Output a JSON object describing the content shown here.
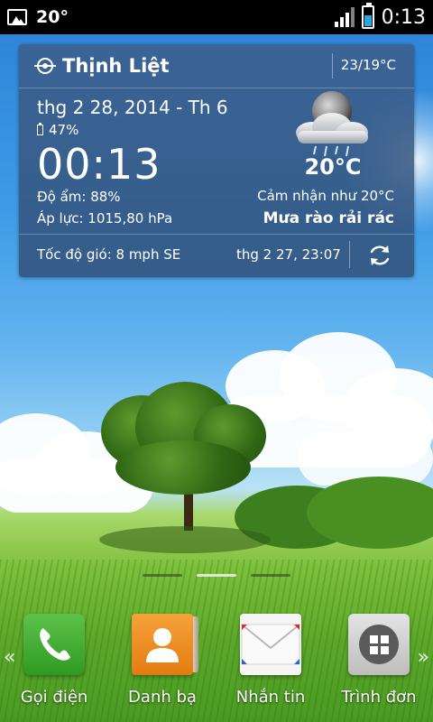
{
  "status_bar": {
    "temperature": "20°",
    "time": "0:13"
  },
  "weather_widget": {
    "location": "Thịnh Liệt",
    "hi_lo": "23/19°C",
    "date": "thg 2 28, 2014 - Th 6",
    "battery": "47%",
    "clock": "00:13",
    "humidity": "Độ ẩm: 88%",
    "pressure": "Áp lực: 1015,80 hPa",
    "temperature": "20°C",
    "feels_like": "Cảm nhận như 20°C",
    "condition": "Mưa rào rải rác",
    "wind": "Tốc độ gió: 8 mph SE",
    "updated": "thg 2 27, 23:07"
  },
  "home": {
    "page_count": 3,
    "active_page": 2
  },
  "dock": {
    "items": [
      {
        "label": "Gọi điện",
        "icon": "phone-icon"
      },
      {
        "label": "Danh bạ",
        "icon": "contacts-icon"
      },
      {
        "label": "Nhắn tin",
        "icon": "messaging-icon"
      },
      {
        "label": "Trình đơn",
        "icon": "app-menu-icon"
      }
    ]
  },
  "colors": {
    "widget_bg": "#3c5f8c",
    "phone_green": "#2e9a22",
    "contacts_orange": "#e27c12",
    "battery_blue": "#2aa6e0"
  }
}
